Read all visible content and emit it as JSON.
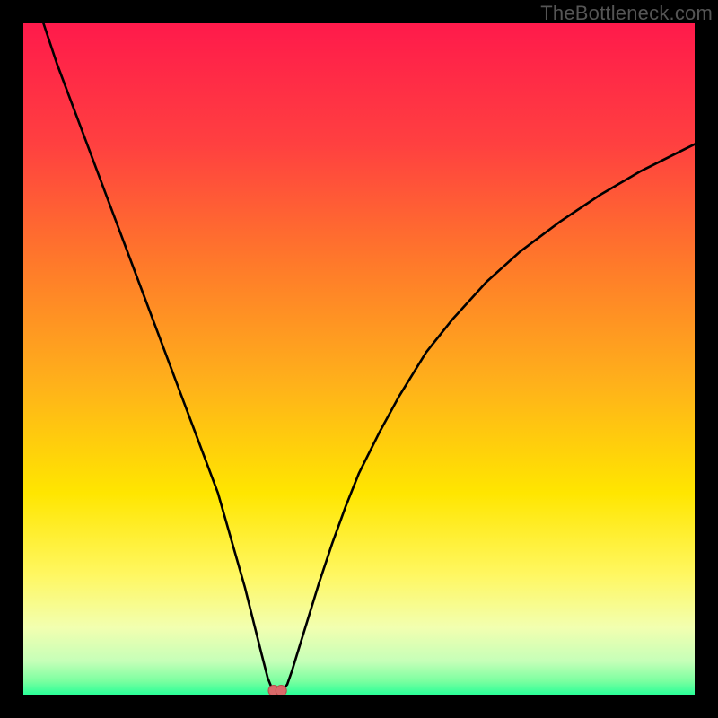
{
  "watermark": "TheBottleneck.com",
  "chart_data": {
    "type": "line",
    "title": "",
    "xlabel": "",
    "ylabel": "",
    "xlim": [
      0,
      100
    ],
    "ylim": [
      0,
      100
    ],
    "grid": false,
    "background_gradient": {
      "stops": [
        {
          "pos": 0.0,
          "color": "#ff1a4b"
        },
        {
          "pos": 0.18,
          "color": "#ff4040"
        },
        {
          "pos": 0.36,
          "color": "#ff7a2a"
        },
        {
          "pos": 0.54,
          "color": "#ffb21a"
        },
        {
          "pos": 0.7,
          "color": "#ffe600"
        },
        {
          "pos": 0.82,
          "color": "#fff760"
        },
        {
          "pos": 0.9,
          "color": "#f2ffb0"
        },
        {
          "pos": 0.95,
          "color": "#c6ffb8"
        },
        {
          "pos": 0.98,
          "color": "#7affa0"
        },
        {
          "pos": 1.0,
          "color": "#2aff98"
        }
      ]
    },
    "series": [
      {
        "name": "bottleneck-curve",
        "stroke": "#000000",
        "stroke_width": 2.6,
        "x": [
          3,
          5,
          8,
          11,
          14,
          17,
          20,
          23,
          26,
          29,
          31,
          33,
          34.5,
          35.5,
          36.4,
          37.0,
          37.7,
          38.5,
          39.3,
          40.0,
          42.0,
          44.0,
          46.0,
          48.0,
          50.0,
          53.0,
          56.0,
          60.0,
          64.0,
          69.0,
          74.0,
          80.0,
          86.0,
          92.0,
          100.0
        ],
        "y": [
          100,
          94,
          86,
          78,
          70,
          62,
          54,
          46,
          38,
          30,
          23,
          16,
          10,
          6,
          2.5,
          1.0,
          0.6,
          0.6,
          1.5,
          3.5,
          10.0,
          16.5,
          22.5,
          28.0,
          33.0,
          39.0,
          44.5,
          51.0,
          56.0,
          61.5,
          66.0,
          70.5,
          74.5,
          78.0,
          82.0
        ]
      },
      {
        "name": "marker-dot",
        "type": "scatter",
        "fill": "#d96a6a",
        "stroke": "#b94a4a",
        "r": 6,
        "points": [
          {
            "x": 37.3,
            "y": 0.6
          },
          {
            "x": 38.4,
            "y": 0.6
          }
        ]
      }
    ]
  }
}
